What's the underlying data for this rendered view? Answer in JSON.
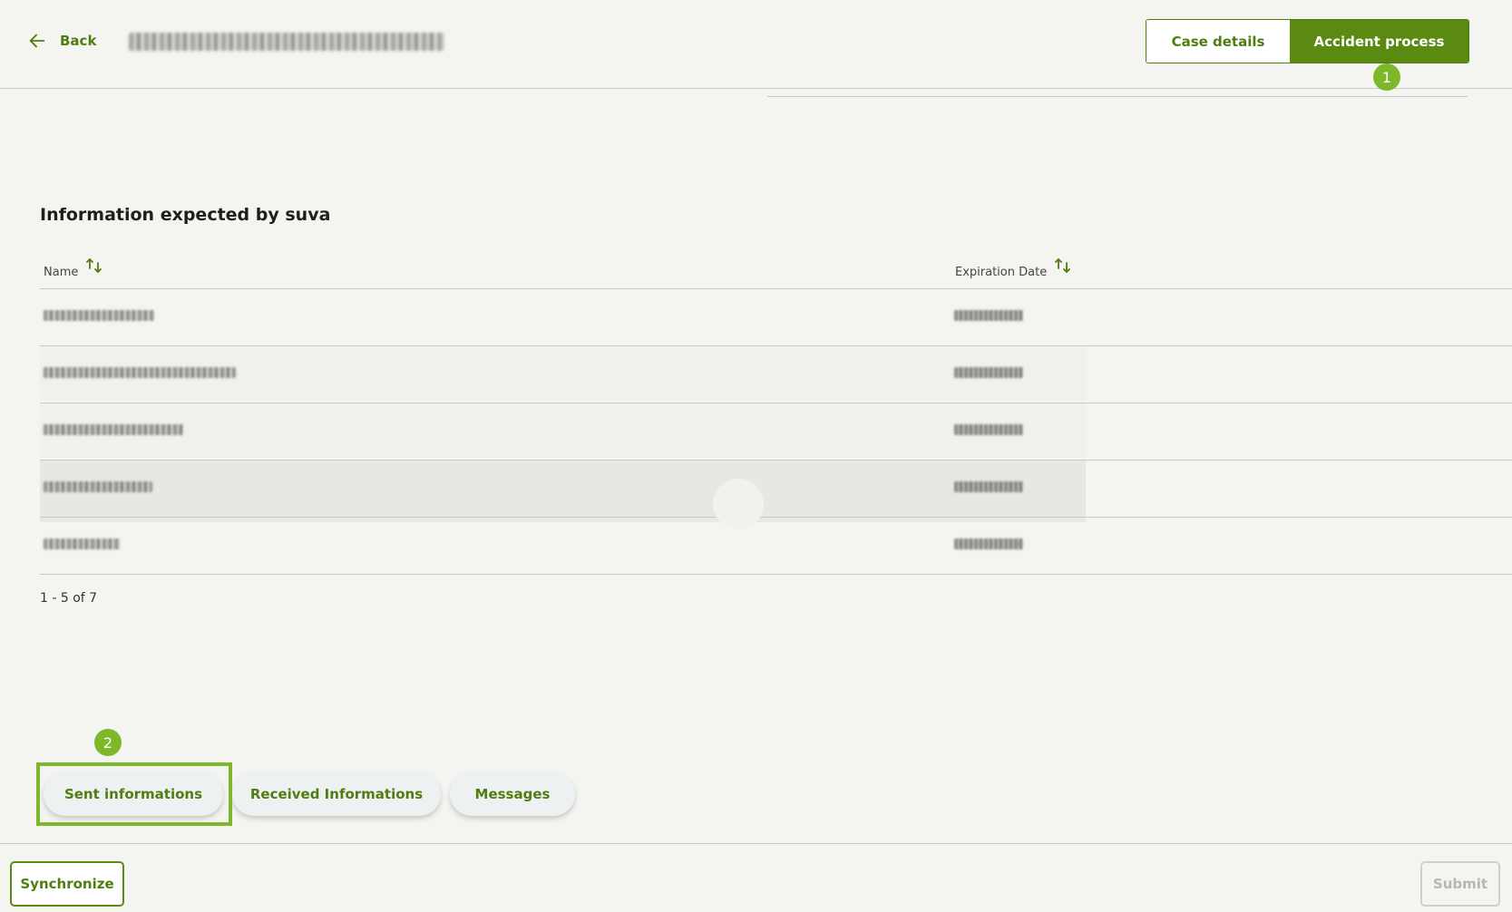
{
  "header": {
    "back_label": "Back",
    "case_reference": "",
    "segments": [
      {
        "label": "Case details",
        "active": false
      },
      {
        "label": "Accident process",
        "active": true
      }
    ],
    "badge_1": "1"
  },
  "section": {
    "title": "Information expected by suva",
    "columns": [
      "Name",
      "Expiration Date"
    ],
    "rows": [
      {
        "name": "",
        "expiration": ""
      },
      {
        "name": "",
        "expiration": ""
      },
      {
        "name": "",
        "expiration": ""
      },
      {
        "name": "",
        "expiration": ""
      },
      {
        "name": "",
        "expiration": ""
      }
    ],
    "pagination": "1 - 5 of 7"
  },
  "tabs": {
    "badge_2": "2",
    "items": [
      "Sent informations",
      "Received Informations",
      "Messages"
    ]
  },
  "footer": {
    "synchronize_label": "Synchronize",
    "submit_label": "Submit"
  },
  "colors": {
    "accent": "#5a8a12",
    "badge": "#7cb82a",
    "background": "#f4f4f0"
  },
  "icons": {
    "back": "arrow-left-icon",
    "sort": "sort-up-down-icon"
  }
}
